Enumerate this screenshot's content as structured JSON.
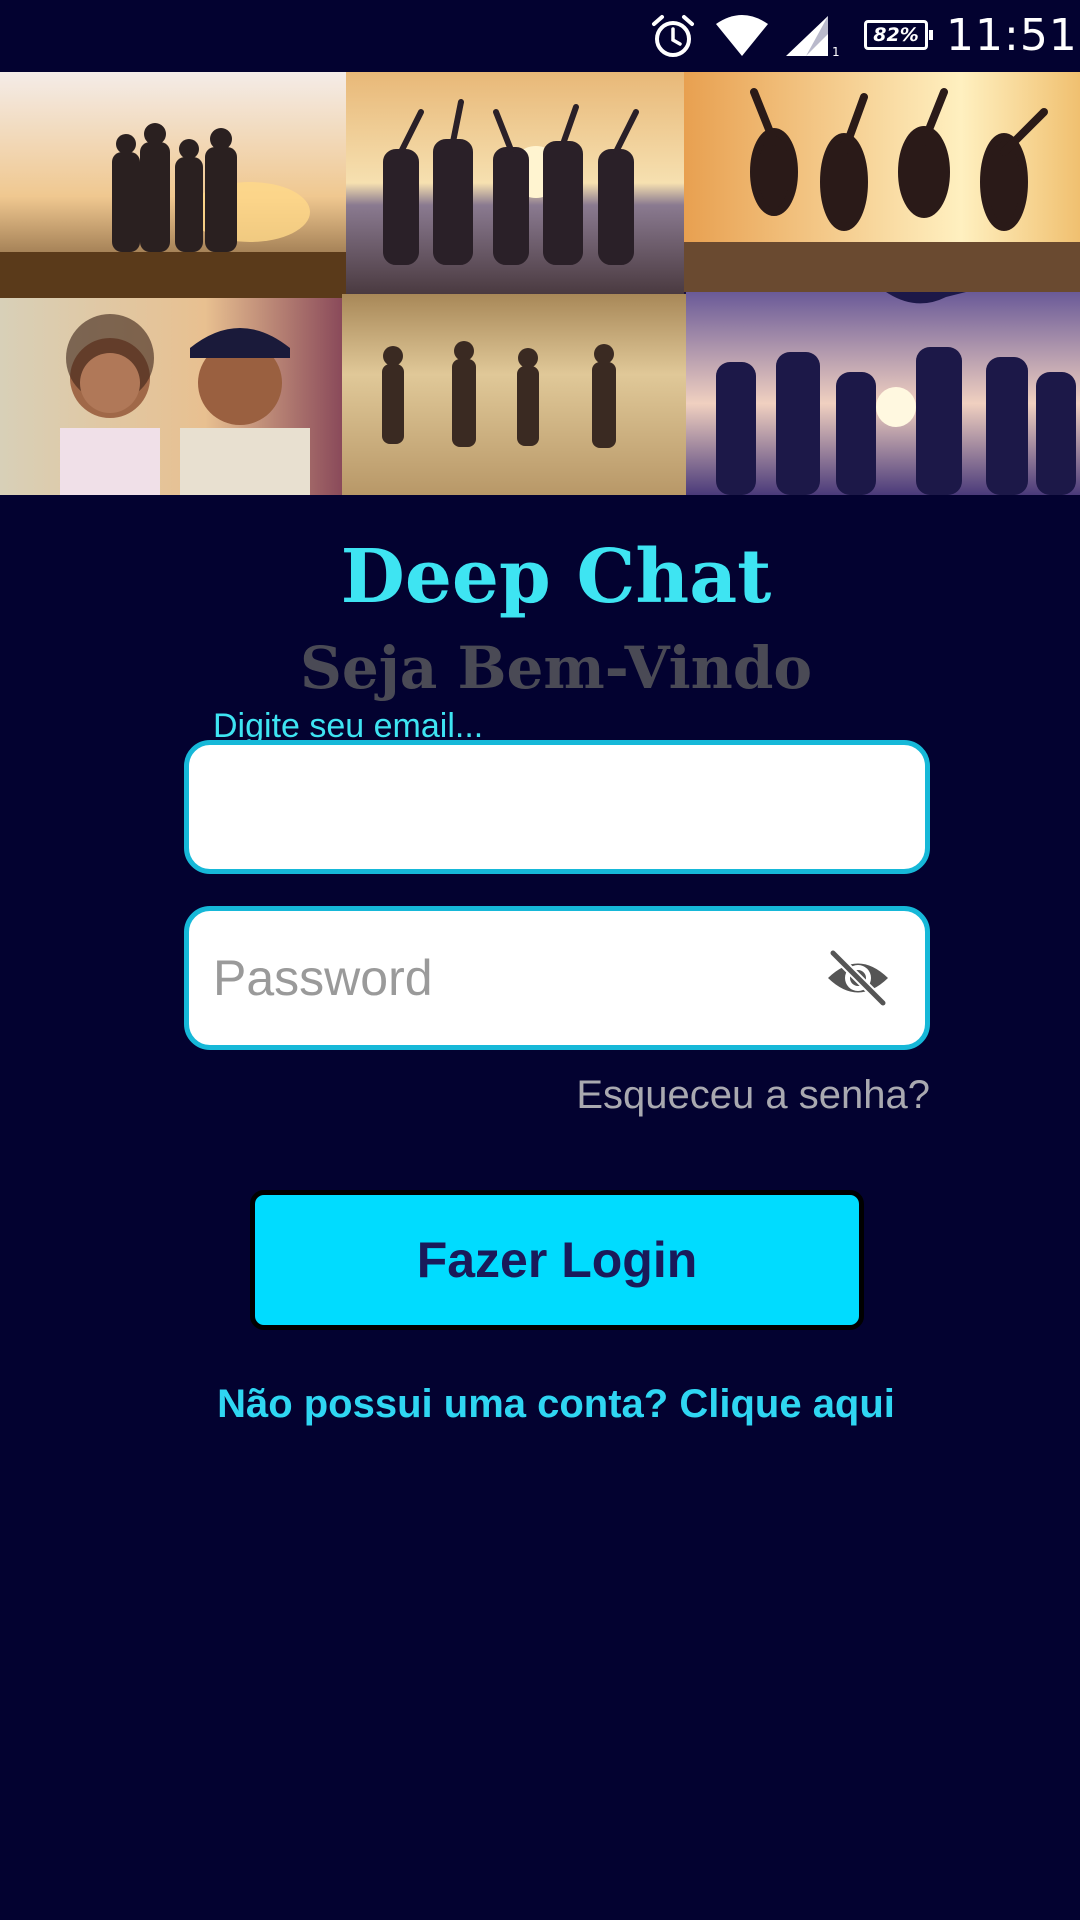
{
  "status_bar": {
    "battery": "82%",
    "time": "11:51",
    "icons": [
      "alarm-icon",
      "wifi-icon",
      "signal-icon",
      "battery-icon"
    ]
  },
  "collage": {
    "photos": [
      "group-hug-sunset-photo",
      "group-hands-up-beach-photo",
      "jumping-friends-sunset-photo",
      "couple-selfie-photo",
      "friends-walking-field-photo",
      "beach-party-silhouette-photo"
    ]
  },
  "header": {
    "title": "Deep Chat",
    "subtitle": "Seja Bem-Vindo"
  },
  "form": {
    "email_label": "Digite seu email...",
    "email_value": "",
    "password_placeholder": "Password",
    "password_value": "",
    "password_toggle_icon": "eye-off-icon",
    "forgot_password": "Esqueceu a senha?",
    "login_button": "Fazer Login",
    "signup_link": "Não possui uma conta? Clique aqui"
  },
  "colors": {
    "background": "#030230",
    "accent": "#3ee4f2",
    "button": "#00dcff",
    "input_border": "#16b8d8"
  }
}
